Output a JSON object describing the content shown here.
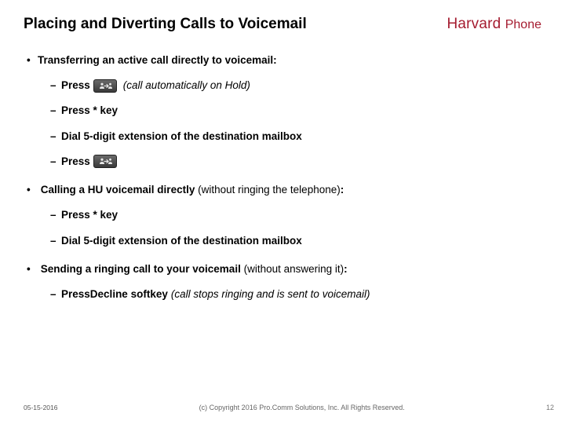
{
  "header": {
    "title": "Placing and Diverting Calls to Voicemail",
    "logo_word1": "Harvard",
    "logo_word2": "Phone"
  },
  "bullets": {
    "b1": "Transferring an active call directly to voicemail:",
    "b1a_press": "Press",
    "b1a_note": "(call automatically on Hold)",
    "b1b": "Press * key",
    "b1c": "Dial 5-digit extension of the destination mailbox",
    "b1d_press": "Press",
    "b2_pre": "Calling a HU voicemail directly",
    "b2_note": "(without ringing the telephone)",
    "b2_colon": ":",
    "b2a": "Press * key",
    "b2b": "Dial 5-digit extension of the destination mailbox",
    "b3_pre": "Sending a ringing call to your voicemail",
    "b3_note": "(without answering it)",
    "b3_colon": ":",
    "b3a_pre": "Press ",
    "b3a_bold": "Decline softkey",
    "b3a_note": "(call stops ringing and is sent to voicemail)"
  },
  "footer": {
    "date": "05-15-2016",
    "copyright": "(c) Copyright 2016 Pro.Comm Solutions, Inc. All Rights Reserved.",
    "page": "12"
  }
}
